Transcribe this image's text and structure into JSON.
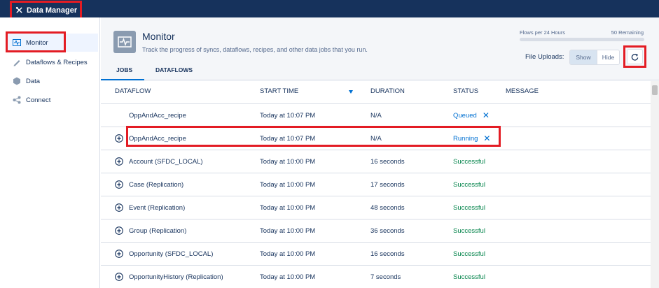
{
  "app": {
    "title": "Data Manager"
  },
  "sidebar": {
    "items": [
      {
        "label": "Monitor",
        "icon": "monitor-icon",
        "active": true
      },
      {
        "label": "Dataflows & Recipes",
        "icon": "pencil-icon"
      },
      {
        "label": "Data",
        "icon": "hexagon-icon"
      },
      {
        "label": "Connect",
        "icon": "connect-icon"
      }
    ]
  },
  "header": {
    "title": "Monitor",
    "subtitle": "Track the progress of syncs, dataflows, recipes, and other data jobs that you run.",
    "limit_label": "Flows per 24 Hours",
    "limit_count": "50 Remaining",
    "file_uploads_label": "File Uploads:",
    "show_label": "Show",
    "hide_label": "Hide"
  },
  "tabs": [
    {
      "label": "JOBS",
      "active": true
    },
    {
      "label": "DATAFLOWS",
      "active": false
    }
  ],
  "table": {
    "columns": [
      "DATAFLOW",
      "START TIME",
      "DURATION",
      "STATUS",
      "MESSAGE"
    ],
    "rows": [
      {
        "name": "OppAndAcc_recipe",
        "start": "Today at 10:07 PM",
        "duration": "N/A",
        "status": "Queued",
        "expandable": false,
        "cancelable": true
      },
      {
        "name": "OppAndAcc_recipe",
        "start": "Today at 10:07 PM",
        "duration": "N/A",
        "status": "Running",
        "expandable": true,
        "cancelable": true
      },
      {
        "name": "Account (SFDC_LOCAL)",
        "start": "Today at 10:00 PM",
        "duration": "16 seconds",
        "status": "Successful",
        "expandable": true
      },
      {
        "name": "Case (Replication)",
        "start": "Today at 10:00 PM",
        "duration": "17 seconds",
        "status": "Successful",
        "expandable": true
      },
      {
        "name": "Event (Replication)",
        "start": "Today at 10:00 PM",
        "duration": "48 seconds",
        "status": "Successful",
        "expandable": true
      },
      {
        "name": "Group (Replication)",
        "start": "Today at 10:00 PM",
        "duration": "36 seconds",
        "status": "Successful",
        "expandable": true
      },
      {
        "name": "Opportunity (SFDC_LOCAL)",
        "start": "Today at 10:00 PM",
        "duration": "16 seconds",
        "status": "Successful",
        "expandable": true
      },
      {
        "name": "OpportunityHistory (Replication)",
        "start": "Today at 10:00 PM",
        "duration": "7 seconds",
        "status": "Successful",
        "expandable": true
      }
    ]
  },
  "colors": {
    "topbar": "#16325c",
    "accent": "#0070d2",
    "success": "#04844b",
    "highlight": "#e31c24"
  }
}
